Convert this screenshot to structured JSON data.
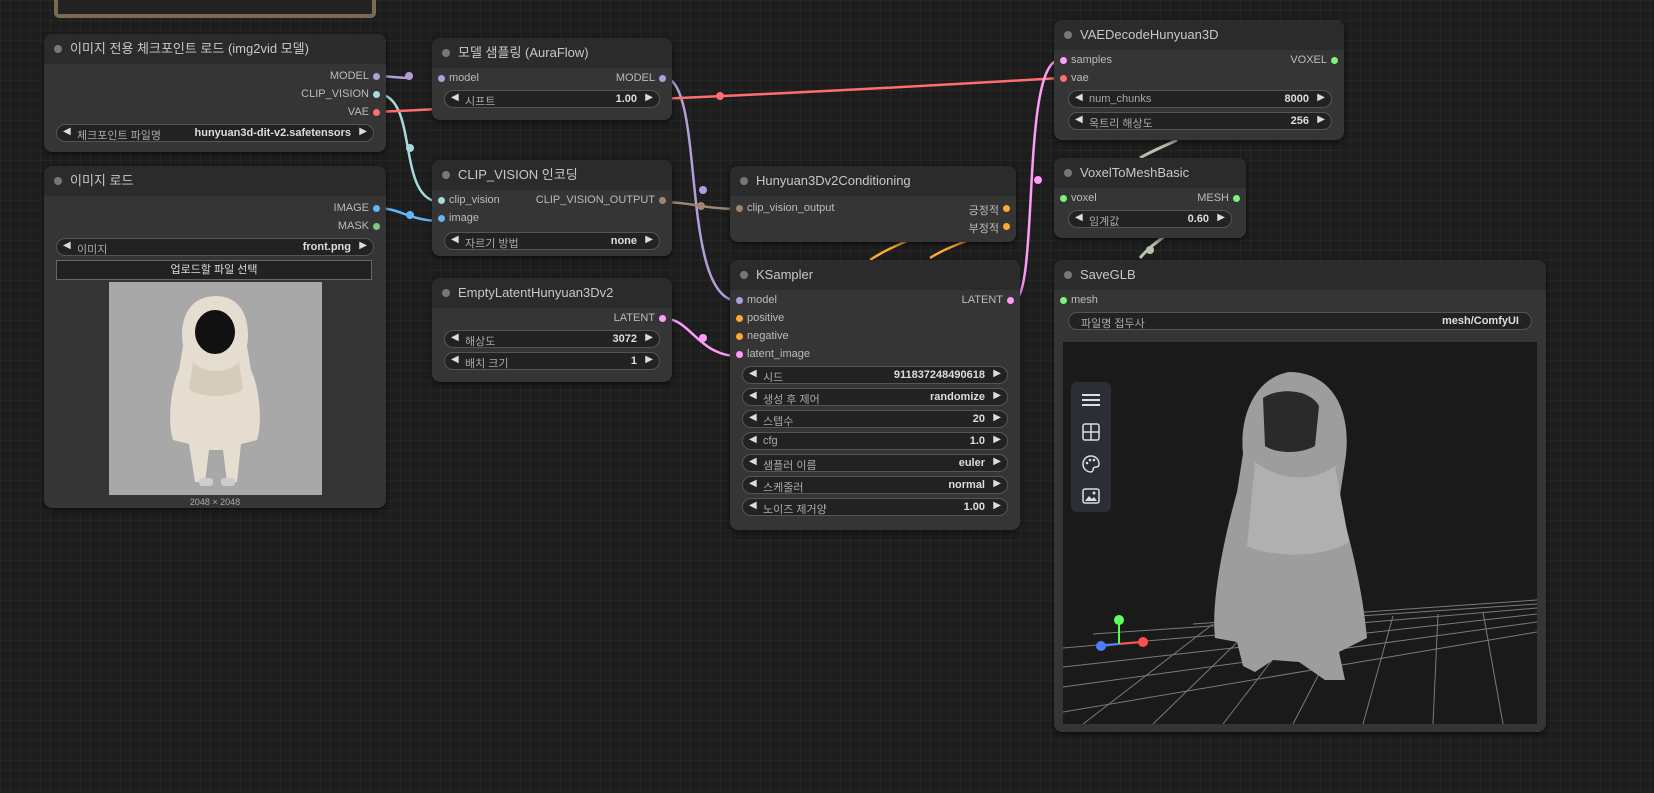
{
  "nodes": {
    "checkpoint": {
      "title": "이미지 전용 체크포인트 로드 (img2vid 모델)",
      "outputs": [
        "MODEL",
        "CLIP_VISION",
        "VAE"
      ],
      "widget": {
        "label": "체크포인트 파일명",
        "value": "hunyuan3d-dit-v2.safetensors"
      }
    },
    "sampling": {
      "title": "모델 샘플링 (AuraFlow)",
      "input": "model",
      "output": "MODEL",
      "widget": {
        "label": "시프트",
        "value": "1.00"
      }
    },
    "clip_encode": {
      "title": "CLIP_VISION 인코딩",
      "inputs": [
        "clip_vision",
        "image"
      ],
      "output": "CLIP_VISION_OUTPUT",
      "widget": {
        "label": "자르기 방법",
        "value": "none"
      }
    },
    "load_image": {
      "title": "이미지 로드",
      "outputs": [
        "IMAGE",
        "MASK"
      ],
      "widget": {
        "label": "이미지",
        "value": "front.png"
      },
      "upload_label": "업로드할 파일 선택",
      "dims": "2048 × 2048"
    },
    "empty_latent": {
      "title": "EmptyLatentHunyuan3Dv2",
      "output": "LATENT",
      "widgets": [
        {
          "label": "해상도",
          "value": "3072"
        },
        {
          "label": "배치 크기",
          "value": "1"
        }
      ]
    },
    "conditioning": {
      "title": "Hunyuan3Dv2Conditioning",
      "input": "clip_vision_output",
      "outputs": [
        "긍정적",
        "부정적"
      ]
    },
    "ksampler": {
      "title": "KSampler",
      "inputs": [
        "model",
        "positive",
        "negative",
        "latent_image"
      ],
      "output": "LATENT",
      "widgets": [
        {
          "label": "시드",
          "value": "911837248490618"
        },
        {
          "label": "생성 후 제어",
          "value": "randomize"
        },
        {
          "label": "스텝수",
          "value": "20"
        },
        {
          "label": "cfg",
          "value": "1.0"
        },
        {
          "label": "샘플러 이름",
          "value": "euler"
        },
        {
          "label": "스케줄러",
          "value": "normal"
        },
        {
          "label": "노이즈 제거양",
          "value": "1.00"
        }
      ]
    },
    "vae_decode": {
      "title": "VAEDecodeHunyuan3D",
      "inputs": [
        "samples",
        "vae"
      ],
      "output": "VOXEL",
      "widgets": [
        {
          "label": "num_chunks",
          "value": "8000"
        },
        {
          "label": "옥트리 해상도",
          "value": "256"
        }
      ]
    },
    "voxel_mesh": {
      "title": "VoxelToMeshBasic",
      "input": "voxel",
      "output": "MESH",
      "widget": {
        "label": "임계값",
        "value": "0.60"
      }
    },
    "save_glb": {
      "title": "SaveGLB",
      "input": "mesh",
      "widget": {
        "label": "파일명 접두사",
        "value": "mesh/ComfyUI"
      },
      "toolbar": [
        "menu-icon",
        "grid-icon",
        "palette-icon",
        "image-icon"
      ]
    }
  },
  "colors": {
    "model": "#b39ddb",
    "clip_vision": "#a8dadc",
    "vae": "#ff6e6e",
    "image": "#64b5f6",
    "mask": "#81c784",
    "conditioning": "#ffa931",
    "latent": "#ff9cf9",
    "clip_vision_output": "#a1866f",
    "voxel": "#7ef07e",
    "mesh": "#7ef07e"
  }
}
